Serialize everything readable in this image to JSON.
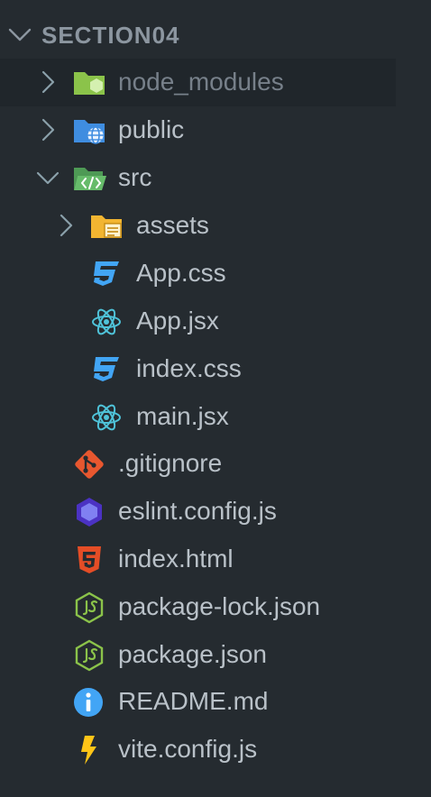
{
  "explorer": {
    "section_title": "SECTION04",
    "items": [
      {
        "label": "node_modules",
        "icon": "node-modules-folder-icon"
      },
      {
        "label": "public",
        "icon": "public-folder-icon"
      },
      {
        "label": "src",
        "icon": "src-folder-open-icon"
      },
      {
        "label": "assets",
        "icon": "assets-folder-icon"
      },
      {
        "label": "App.css",
        "icon": "css-file-icon"
      },
      {
        "label": "App.jsx",
        "icon": "react-file-icon"
      },
      {
        "label": "index.css",
        "icon": "css-file-icon"
      },
      {
        "label": "main.jsx",
        "icon": "react-file-icon"
      },
      {
        "label": ".gitignore",
        "icon": "git-file-icon"
      },
      {
        "label": "eslint.config.js",
        "icon": "eslint-file-icon"
      },
      {
        "label": "index.html",
        "icon": "html-file-icon"
      },
      {
        "label": "package-lock.json",
        "icon": "nodejs-file-icon"
      },
      {
        "label": "package.json",
        "icon": "nodejs-file-icon"
      },
      {
        "label": "README.md",
        "icon": "info-file-icon"
      },
      {
        "label": "vite.config.js",
        "icon": "vite-file-icon"
      }
    ]
  }
}
